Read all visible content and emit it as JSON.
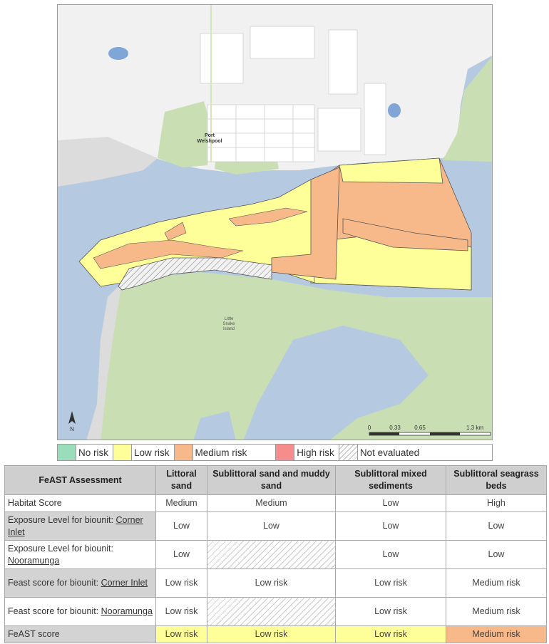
{
  "map": {
    "place_labels": {
      "town": "Port\nWelshpool",
      "island": "Little\nSnake\nIsland"
    },
    "north_label": "N",
    "scale": {
      "ticks": [
        "0",
        "0.33",
        "0.65",
        "1.3 km"
      ]
    }
  },
  "legend": [
    {
      "label": "No risk",
      "color": "#99ddbb"
    },
    {
      "label": "Low risk",
      "color": "#ffff99"
    },
    {
      "label": "Medium risk",
      "color": "#f7b98a"
    },
    {
      "label": "High risk",
      "color": "#f78c8c"
    },
    {
      "label": "Not evaluated",
      "color": "hatched"
    }
  ],
  "table": {
    "headers": [
      "FeAST Assessment",
      "Littoral sand",
      "Sublittoral sand and muddy sand",
      "Sublittoral mixed sediments",
      "Sublittoral seagrass beds"
    ],
    "rows": [
      {
        "label_pre": "Habitat Score",
        "label_link": "",
        "values": [
          "Medium",
          "Medium",
          "Low",
          "High"
        ]
      },
      {
        "label_pre": "Exposure Level for biounit: ",
        "label_link": "Corner Inlet",
        "values": [
          "Low",
          "Low",
          "Low",
          "Low"
        ]
      },
      {
        "label_pre": "Exposure Level for biounit: ",
        "label_link": "Nooramunga",
        "values": [
          "Low",
          "",
          "Low",
          "Low"
        ]
      },
      {
        "label_pre": "Feast score for biounit: ",
        "label_link": "Corner Inlet",
        "values": [
          "Low risk",
          "Low risk",
          "Low risk",
          "Medium risk"
        ]
      },
      {
        "label_pre": "Feast score for biounit: ",
        "label_link": "Nooramunga",
        "values": [
          "Low risk",
          "",
          "Low risk",
          "Medium risk"
        ]
      },
      {
        "label_pre": "FeAST score",
        "label_link": "",
        "values": [
          "Low risk",
          "Low risk",
          "Low risk",
          "Medium risk"
        ]
      }
    ]
  }
}
